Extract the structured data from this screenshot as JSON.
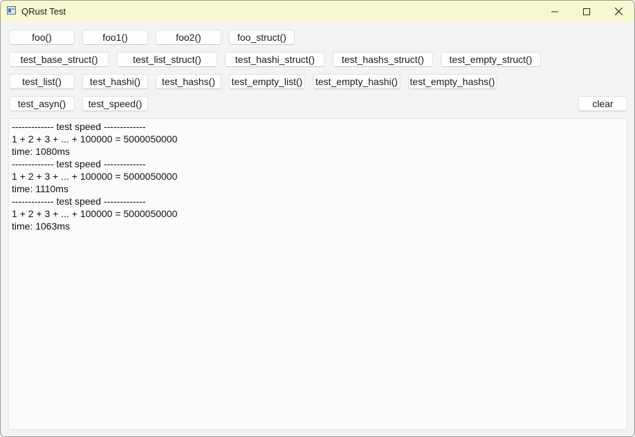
{
  "window": {
    "title": "QRust Test",
    "controls": {
      "minimize": "─",
      "maximize": "☐",
      "close": "✕"
    }
  },
  "buttons": {
    "row1": [
      "foo()",
      "foo1()",
      "foo2()",
      "foo_struct()"
    ],
    "row2": [
      "test_base_struct()",
      "test_list_struct()",
      "test_hashi_struct()",
      "test_hashs_struct()",
      "test_empty_struct()"
    ],
    "row3": [
      "test_list()",
      "test_hashi()",
      "test_hashs()",
      "test_empty_list()",
      "test_empty_hashi()",
      "test_empty_hashs()"
    ],
    "row4": [
      "test_asyn()",
      "test_speed()"
    ],
    "clear": "clear"
  },
  "output": {
    "lines": [
      "------------- test speed -------------",
      "1 + 2 + 3 + ... + 100000 = 5000050000",
      "time: 1080ms",
      "------------- test speed -------------",
      "1 + 2 + 3 + ... + 100000 = 5000050000",
      "time: 1110ms",
      "------------- test speed -------------",
      "1 + 2 + 3 + ... + 100000 = 5000050000",
      "time: 1063ms"
    ]
  }
}
